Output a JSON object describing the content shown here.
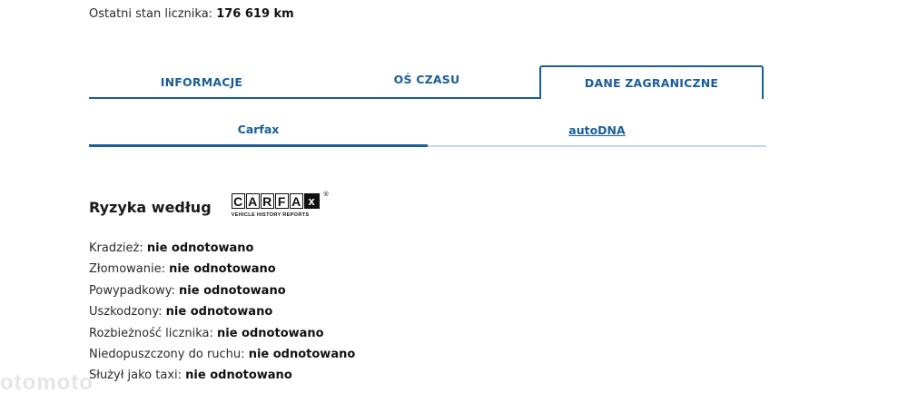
{
  "odometer": {
    "label": "Ostatni stan licznika:",
    "value": "176 619 km"
  },
  "main_tabs": [
    {
      "label": "INFORMACJE"
    },
    {
      "label": "OŚ CZASU"
    },
    {
      "label": "DANE ZAGRANICZNE",
      "active": true
    }
  ],
  "sub_tabs": [
    {
      "label": "Carfax",
      "active": true
    },
    {
      "label": "autoDNA"
    }
  ],
  "risk": {
    "heading": "Ryzyka według",
    "logo_letters": [
      "C",
      "A",
      "R",
      "F",
      "A",
      "x"
    ],
    "logo_registered": "®",
    "logo_tagline": "VEHICLE HISTORY REPORTS"
  },
  "facts": [
    {
      "label": "Kradzież:",
      "value": "nie odnotowano"
    },
    {
      "label": "Złomowanie:",
      "value": "nie odnotowano"
    },
    {
      "label": "Powypadkowy:",
      "value": "nie odnotowano"
    },
    {
      "label": "Uszkodzony:",
      "value": "nie odnotowano"
    },
    {
      "label": "Rozbieżność licznika:",
      "value": "nie odnotowano"
    },
    {
      "label": "Niedopuszczony do ruchu:",
      "value": "nie odnotowano"
    },
    {
      "label": "Służył jako taxi:",
      "value": "nie odnotowano"
    }
  ],
  "watermark": "otomoto",
  "colors": {
    "accent": "#1a5d9a",
    "inactive_underline": "#c3d9e9"
  }
}
